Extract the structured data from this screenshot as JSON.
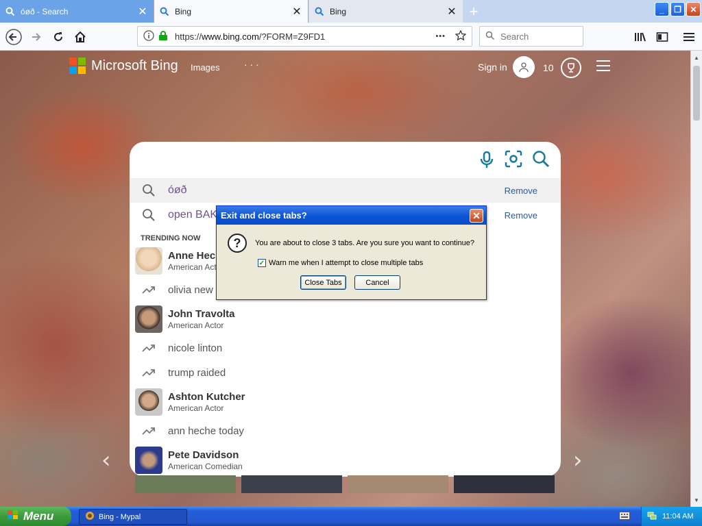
{
  "browser": {
    "tabs": [
      {
        "label": "óøð - Search"
      },
      {
        "label": "Bing"
      },
      {
        "label": "Bing"
      }
    ],
    "url_prefix": "https://",
    "url_host": "www.bing.com",
    "url_path": "/?FORM=Z9FD1",
    "search_placeholder": "Search",
    "more_glyph": "•••"
  },
  "bing": {
    "logo_text": "Microsoft Bing",
    "nav_images": "Images",
    "nav_more": "· · ·",
    "sign_in": "Sign in",
    "rewards_count": "10",
    "recent": [
      {
        "text": "óøð",
        "remove": "Remove"
      },
      {
        "text": "open BAK",
        "remove": "Remove"
      }
    ],
    "trending_title": "TRENDING NOW",
    "trending": [
      {
        "name": "Anne Hec",
        "subtitle": "American Act"
      },
      {
        "term": "olivia new"
      },
      {
        "name": "John Travolta",
        "subtitle": "American Actor"
      },
      {
        "term": "nicole linton"
      },
      {
        "term": "trump raided"
      },
      {
        "name": "Ashton Kutcher",
        "subtitle": "American Actor"
      },
      {
        "term": "ann heche today"
      },
      {
        "name": "Pete Davidson",
        "subtitle": "American Comedian"
      }
    ]
  },
  "dialog": {
    "title": "Exit and close tabs?",
    "message": "You are about to close 3 tabs. Are you sure you want to continue?",
    "checkbox_label": "Warn me when I attempt to close multiple tabs",
    "checkbox_checked": true,
    "confirm_label": "Close Tabs",
    "cancel_label": "Cancel"
  },
  "taskbar": {
    "start_label": "Menu",
    "task_label": "Bing - Mypal",
    "clock": "11:04 AM"
  },
  "colors": {
    "ms_red": "#f25022",
    "ms_green": "#7fba00",
    "ms_blue": "#00a4ef",
    "ms_yellow": "#ffb900",
    "bing_teal": "#1a7b9c",
    "link_purple": "#70508f"
  },
  "icons": [
    "search-icon",
    "close-icon",
    "plus-icon",
    "back-icon",
    "forward-icon",
    "reload-icon",
    "home-icon",
    "info-icon",
    "lock-icon",
    "star-icon",
    "library-icon",
    "sidebar-icon",
    "menu-icon",
    "microphone-icon",
    "visual-search-icon",
    "trending-icon",
    "trophy-icon",
    "question-icon",
    "user-icon"
  ]
}
